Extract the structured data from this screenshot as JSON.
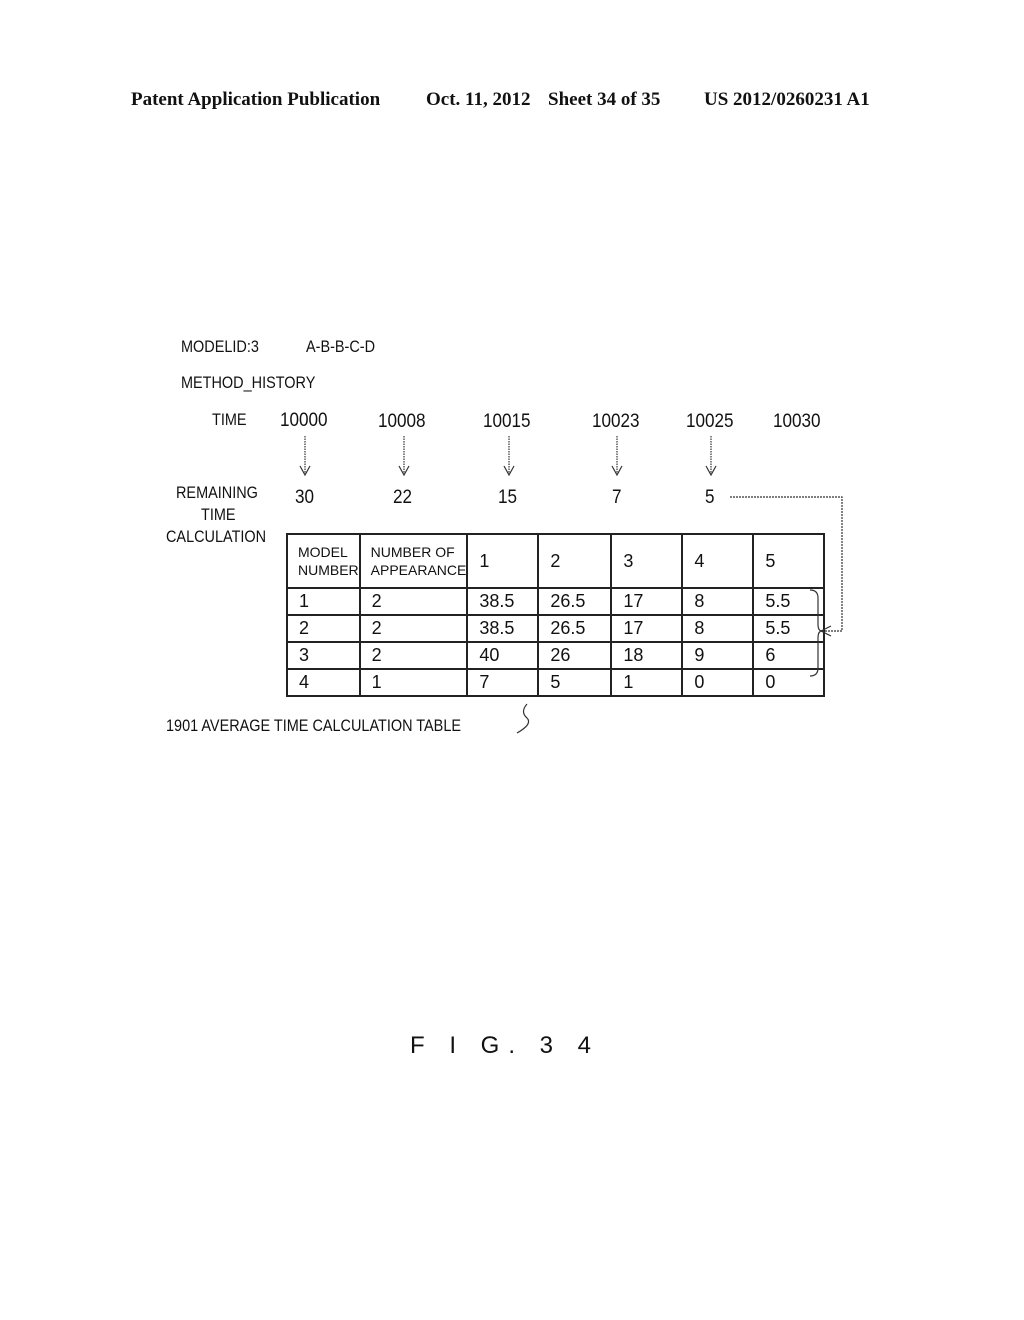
{
  "header": {
    "publication": "Patent Application Publication",
    "date": "Oct. 11, 2012",
    "sheet": "Sheet 34 of 35",
    "number": "US 2012/0260231 A1"
  },
  "figure": {
    "modelid_label": "MODELID:3",
    "sequence": "A-B-B-C-D",
    "method_history_label": "METHOD_HISTORY",
    "time_label": "TIME",
    "times": [
      "10000",
      "10008",
      "10015",
      "10023",
      "10025",
      "10030"
    ],
    "remaining_label_lines": [
      "REMAINING",
      "TIME",
      "CALCULATION"
    ],
    "remaining_values": [
      "30",
      "22",
      "15",
      "7",
      "5"
    ],
    "table": {
      "headers": [
        [
          "MODEL",
          "NUMBER"
        ],
        [
          "NUMBER OF",
          "APPEARANCE"
        ],
        "1",
        "2",
        "3",
        "4",
        "5"
      ],
      "rows": [
        [
          "1",
          "2",
          "38.5",
          "26.5",
          "17",
          "8",
          "5.5"
        ],
        [
          "2",
          "2",
          "38.5",
          "26.5",
          "17",
          "8",
          "5.5"
        ],
        [
          "3",
          "2",
          "40",
          "26",
          "18",
          "9",
          "6"
        ],
        [
          "4",
          "1",
          "7",
          "5",
          "1",
          "0",
          "0"
        ]
      ],
      "caption": "1901 AVERAGE TIME CALCULATION TABLE"
    },
    "fig_label": "F I G. 3 4"
  }
}
